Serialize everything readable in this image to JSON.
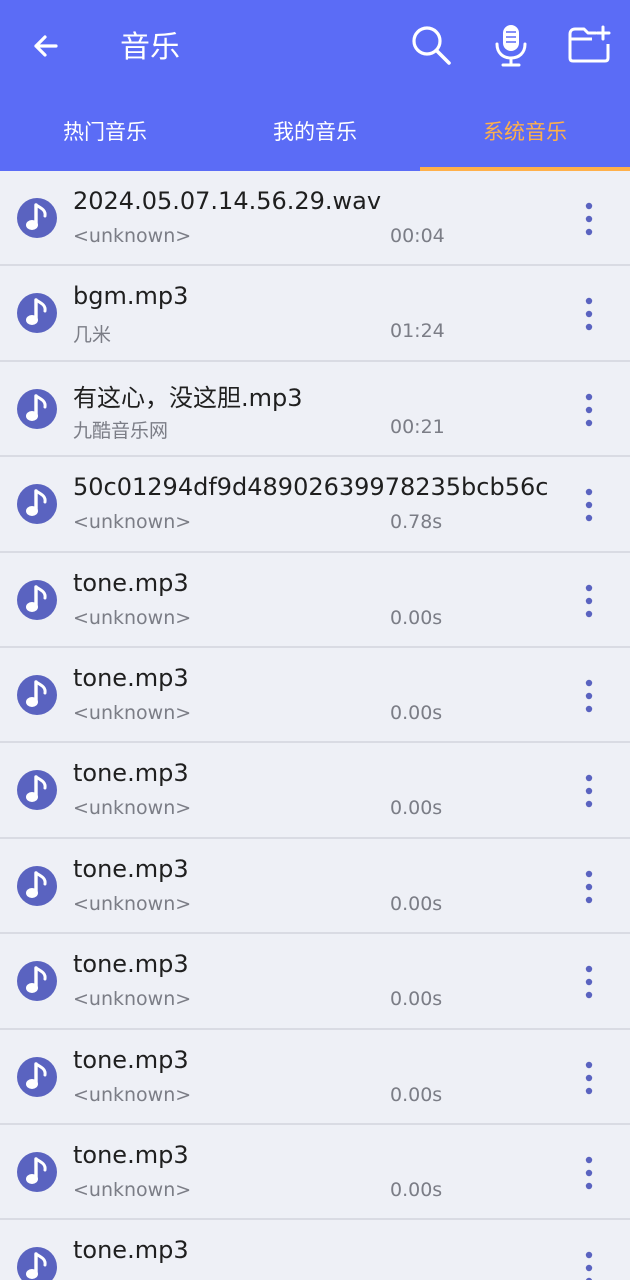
{
  "header": {
    "title": "音乐",
    "icons": [
      "back-arrow-icon",
      "search-icon",
      "microphone-icon",
      "folder-add-icon"
    ]
  },
  "tabs": [
    {
      "label": "热门音乐",
      "selected": false
    },
    {
      "label": "我的音乐",
      "selected": false
    },
    {
      "label": "系统音乐",
      "selected": true
    }
  ],
  "colors": {
    "header_bg": "#5b6cf6",
    "tab_selected": "#ffb04a",
    "icon_blue": "#5a63c0",
    "list_bg": "#eef0f6"
  },
  "songs": [
    {
      "name": "2024.05.07.14.56.29.wav",
      "artist": "<unknown>",
      "duration": "00:04"
    },
    {
      "name": "bgm.mp3",
      "artist": "几米",
      "duration": "01:24"
    },
    {
      "name": "有这心，没这胆.mp3",
      "artist": "九酷音乐网",
      "duration": "00:21"
    },
    {
      "name": "50c01294df9d48902639978235bcb56c",
      "artist": "<unknown>",
      "duration": "0.78s"
    },
    {
      "name": "tone.mp3",
      "artist": "<unknown>",
      "duration": "0.00s"
    },
    {
      "name": "tone.mp3",
      "artist": "<unknown>",
      "duration": "0.00s"
    },
    {
      "name": "tone.mp3",
      "artist": "<unknown>",
      "duration": "0.00s"
    },
    {
      "name": "tone.mp3",
      "artist": "<unknown>",
      "duration": "0.00s"
    },
    {
      "name": "tone.mp3",
      "artist": "<unknown>",
      "duration": "0.00s"
    },
    {
      "name": "tone.mp3",
      "artist": "<unknown>",
      "duration": "0.00s"
    },
    {
      "name": "tone.mp3",
      "artist": "<unknown>",
      "duration": "0.00s"
    },
    {
      "name": "tone.mp3",
      "artist": "",
      "duration": ""
    }
  ]
}
